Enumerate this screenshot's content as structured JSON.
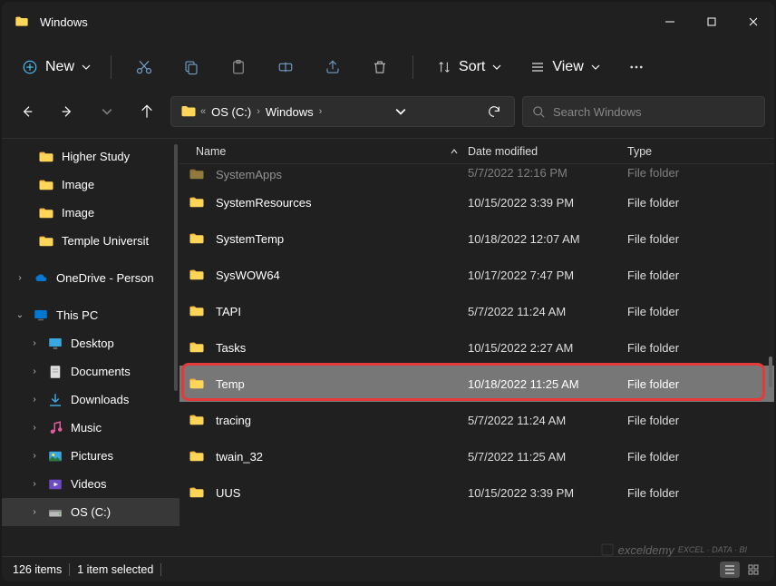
{
  "title": "Windows",
  "toolbar": {
    "new": "New",
    "sort": "Sort",
    "view": "View"
  },
  "breadcrumbs": [
    "OS (C:)",
    "Windows"
  ],
  "search_placeholder": "Search Windows",
  "columns": {
    "name": "Name",
    "date": "Date modified",
    "type": "Type"
  },
  "sidebar": {
    "quick": [
      {
        "label": "Higher Study",
        "icon": "folder"
      },
      {
        "label": "Image",
        "icon": "folder"
      },
      {
        "label": "Image",
        "icon": "folder"
      },
      {
        "label": "Temple Universit",
        "icon": "folder"
      }
    ],
    "onedrive": "OneDrive - Person",
    "thispc": {
      "label": "This PC",
      "children": [
        {
          "label": "Desktop",
          "icon": "desktop"
        },
        {
          "label": "Documents",
          "icon": "documents"
        },
        {
          "label": "Downloads",
          "icon": "downloads"
        },
        {
          "label": "Music",
          "icon": "music"
        },
        {
          "label": "Pictures",
          "icon": "pictures"
        },
        {
          "label": "Videos",
          "icon": "videos"
        },
        {
          "label": "OS (C:)",
          "icon": "disk",
          "selected": true
        }
      ]
    }
  },
  "files": [
    {
      "name": "SystemApps",
      "date": "5/7/2022 12:16 PM",
      "type": "File folder",
      "partial": true
    },
    {
      "name": "SystemResources",
      "date": "10/15/2022 3:39 PM",
      "type": "File folder"
    },
    {
      "name": "SystemTemp",
      "date": "10/18/2022 12:07 AM",
      "type": "File folder"
    },
    {
      "name": "SysWOW64",
      "date": "10/17/2022 7:47 PM",
      "type": "File folder"
    },
    {
      "name": "TAPI",
      "date": "5/7/2022 11:24 AM",
      "type": "File folder"
    },
    {
      "name": "Tasks",
      "date": "10/15/2022 2:27 AM",
      "type": "File folder"
    },
    {
      "name": "Temp",
      "date": "10/18/2022 11:25 AM",
      "type": "File folder",
      "selected": true,
      "highlighted": true
    },
    {
      "name": "tracing",
      "date": "5/7/2022 11:24 AM",
      "type": "File folder"
    },
    {
      "name": "twain_32",
      "date": "5/7/2022 11:25 AM",
      "type": "File folder"
    },
    {
      "name": "UUS",
      "date": "10/15/2022 3:39 PM",
      "type": "File folder"
    }
  ],
  "status": {
    "count": "126 items",
    "selection": "1 item selected"
  },
  "watermark": "exceldemy"
}
